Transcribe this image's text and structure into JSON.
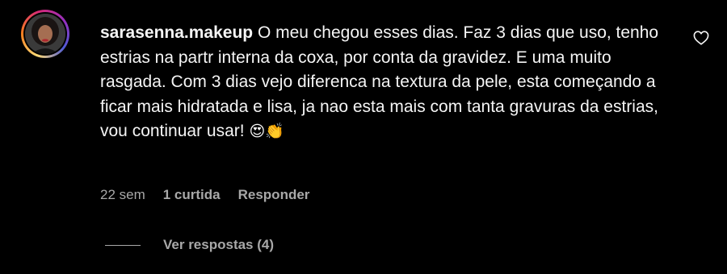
{
  "comment": {
    "username": "sarasenna.makeup",
    "text": "O meu chegou esses dias. Faz 3 dias que uso, tenho estrias na partr interna da coxa, por conta da gravidez. E uma muito rasgada. Com 3 dias vejo diferenca na textura da pele, esta começando a ficar mais hidratada e lisa, ja nao esta mais com tanta gravuras da estrias, vou continuar usar!",
    "emojis": "😍👏",
    "time": "22 sem",
    "likes": "1 curtida",
    "reply_label": "Responder",
    "view_replies": "Ver respostas (4)"
  },
  "icons": {
    "like": "heart-outline-icon"
  },
  "colors": {
    "background": "#000000",
    "text": "#f5f5f5",
    "secondary": "#a8a8a8"
  }
}
